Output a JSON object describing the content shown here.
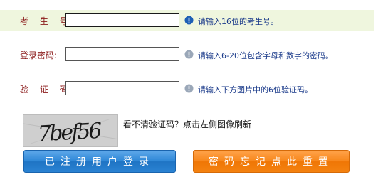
{
  "form": {
    "rows": [
      {
        "label": "考 生 号:",
        "value": "",
        "placeholder": "",
        "hint": "请输入16位的考生号。",
        "hint_icon": "info-icon-blue"
      },
      {
        "label": "登录密码:",
        "value": "",
        "placeholder": "",
        "hint": "请输入6-20位包含字母和数字的密码。",
        "hint_icon": "info-icon-gray"
      },
      {
        "label": "验 证 码:",
        "value": "",
        "placeholder": "",
        "hint": "请输入下方图片中的6位验证码。",
        "hint_icon": "info-icon-gray"
      }
    ]
  },
  "captcha": {
    "image_text": "7bef56",
    "note": "看不清验证码？点击左侧图像刷新"
  },
  "buttons": {
    "login_label": "已注册用户登录",
    "reset_label": "密码忘记点此重置"
  },
  "colors": {
    "label": "#8b1a1a",
    "hint": "#1a3a8a",
    "highlight_row": "#eff6de",
    "login_button": "#2d86d6",
    "reset_button": "#f7861a",
    "info_icon_active": "#1e5fb5",
    "info_icon_inactive": "#9aa7b8"
  }
}
